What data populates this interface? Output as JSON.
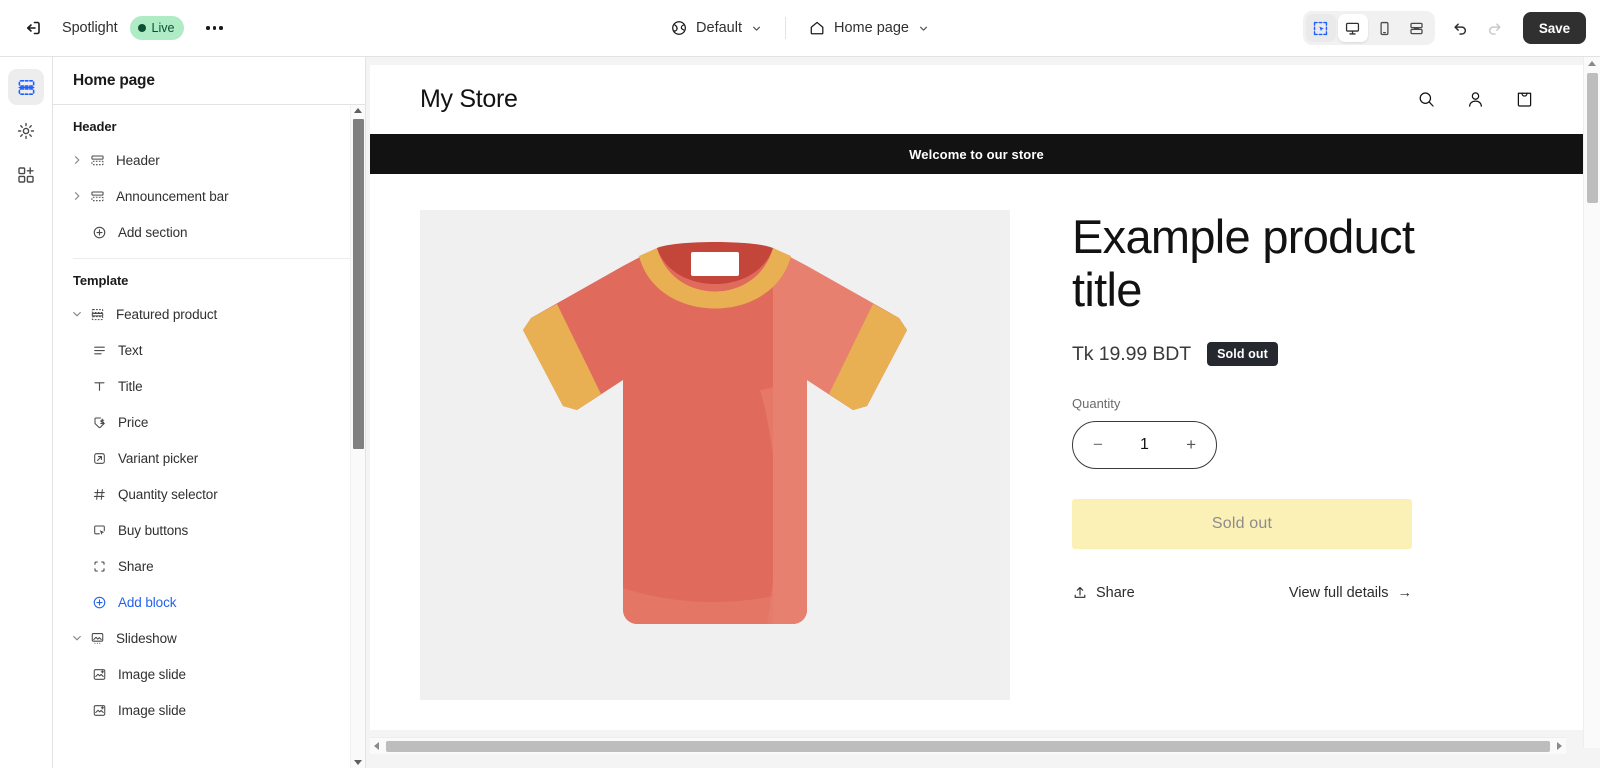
{
  "topbar": {
    "exit_icon": "exit-icon",
    "theme_name": "Spotlight",
    "status_badge": "Live",
    "more_label": "…",
    "market_icon": "globe-icon",
    "market_value": "Default",
    "page_icon": "home-icon",
    "page_value": "Home page",
    "views": [
      {
        "name": "inspector",
        "icon": "select-cursor-icon",
        "active": true
      },
      {
        "name": "desktop",
        "icon": "desktop-icon",
        "active": true
      },
      {
        "name": "mobile",
        "icon": "mobile-icon",
        "active": false
      },
      {
        "name": "fullscreen",
        "icon": "resize-icon",
        "active": false
      }
    ],
    "undo_icon": "undo-icon",
    "redo_icon": "redo-icon",
    "save_label": "Save",
    "accent_blue": "#1f5eff",
    "badge_green_bg": "#afebc4",
    "badge_green_fg": "#0c5132",
    "save_bg": "#303030"
  },
  "rail": {
    "items": [
      {
        "name": "sections",
        "icon": "sections-icon",
        "active": true
      },
      {
        "name": "theme-settings",
        "icon": "gear-icon",
        "active": false
      },
      {
        "name": "apps",
        "icon": "apps-add-icon",
        "active": false
      }
    ]
  },
  "panel": {
    "title": "Home page",
    "groups": [
      {
        "label": "Header",
        "rows": [
          {
            "label": "Header",
            "icon": "section-icon",
            "caret": "right",
            "kind": "section"
          },
          {
            "label": "Announcement bar",
            "icon": "section-icon",
            "caret": "right",
            "kind": "section"
          },
          {
            "label": "Add section",
            "icon": "plus-circle-icon",
            "kind": "add"
          }
        ]
      },
      {
        "label": "Template",
        "rows": [
          {
            "label": "Featured product",
            "icon": "section-icon",
            "caret": "down",
            "kind": "section"
          },
          {
            "label": "Text",
            "icon": "text-lines-icon",
            "kind": "block"
          },
          {
            "label": "Title",
            "icon": "title-t-icon",
            "kind": "block"
          },
          {
            "label": "Price",
            "icon": "price-tag-icon",
            "kind": "block"
          },
          {
            "label": "Variant picker",
            "icon": "variant-picker-icon",
            "kind": "block"
          },
          {
            "label": "Quantity selector",
            "icon": "hash-icon",
            "kind": "block"
          },
          {
            "label": "Buy buttons",
            "icon": "buy-button-icon",
            "kind": "block"
          },
          {
            "label": "Share",
            "icon": "share-brackets-icon",
            "kind": "block"
          },
          {
            "label": "Add block",
            "icon": "plus-circle-icon",
            "kind": "add"
          },
          {
            "label": "Slideshow",
            "icon": "slideshow-icon",
            "caret": "down",
            "kind": "section"
          },
          {
            "label": "Image slide",
            "icon": "image-slide-icon",
            "kind": "block"
          },
          {
            "label": "Image slide",
            "icon": "image-slide-icon",
            "kind": "block"
          }
        ]
      }
    ]
  },
  "preview": {
    "store_name": "My Store",
    "header_icons": [
      {
        "name": "search-icon"
      },
      {
        "name": "account-icon"
      },
      {
        "name": "cart-icon"
      }
    ],
    "announcement": "Welcome to our store",
    "product": {
      "image_alt": "tshirt-placeholder-image",
      "title": "Example product title",
      "price": "Tk 19.99 BDT",
      "badge": "Sold out",
      "quantity_label": "Quantity",
      "quantity_minus": "−",
      "quantity_value": "1",
      "quantity_plus": "+",
      "buy_button": "Sold out",
      "share_label": "Share",
      "details_label": "View full details",
      "details_arrow": "→",
      "colors": {
        "shirt": "#e06a5b",
        "shirt_shade": "#e8806f",
        "trim": "#e8b052",
        "collar_inner": "#c4453a",
        "tag": "#ffffff",
        "media_bg": "#f0f0f0",
        "announcement_bg": "#121212",
        "buy_button_bg": "#fbf0b6",
        "badge_bg": "#25282e"
      }
    }
  }
}
